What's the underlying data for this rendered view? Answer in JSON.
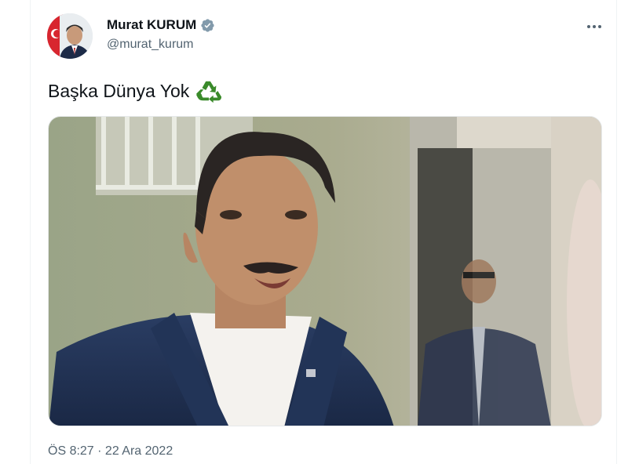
{
  "author": {
    "name": "Murat KURUM",
    "handle": "@murat_kurum",
    "verified": true
  },
  "tweet": {
    "text": "Başka Dünya Yok",
    "emoji_icon": "recycle-icon",
    "timestamp": "ÖS 8:27 · 22 Ara 2022"
  },
  "icons": {
    "more": "more-options-icon",
    "verified": "verified-badge-icon"
  },
  "colors": {
    "verified_badge": "#829aab",
    "recycle": "#3a8a2a",
    "secondary_text": "#536471",
    "primary_text": "#0f1419"
  }
}
